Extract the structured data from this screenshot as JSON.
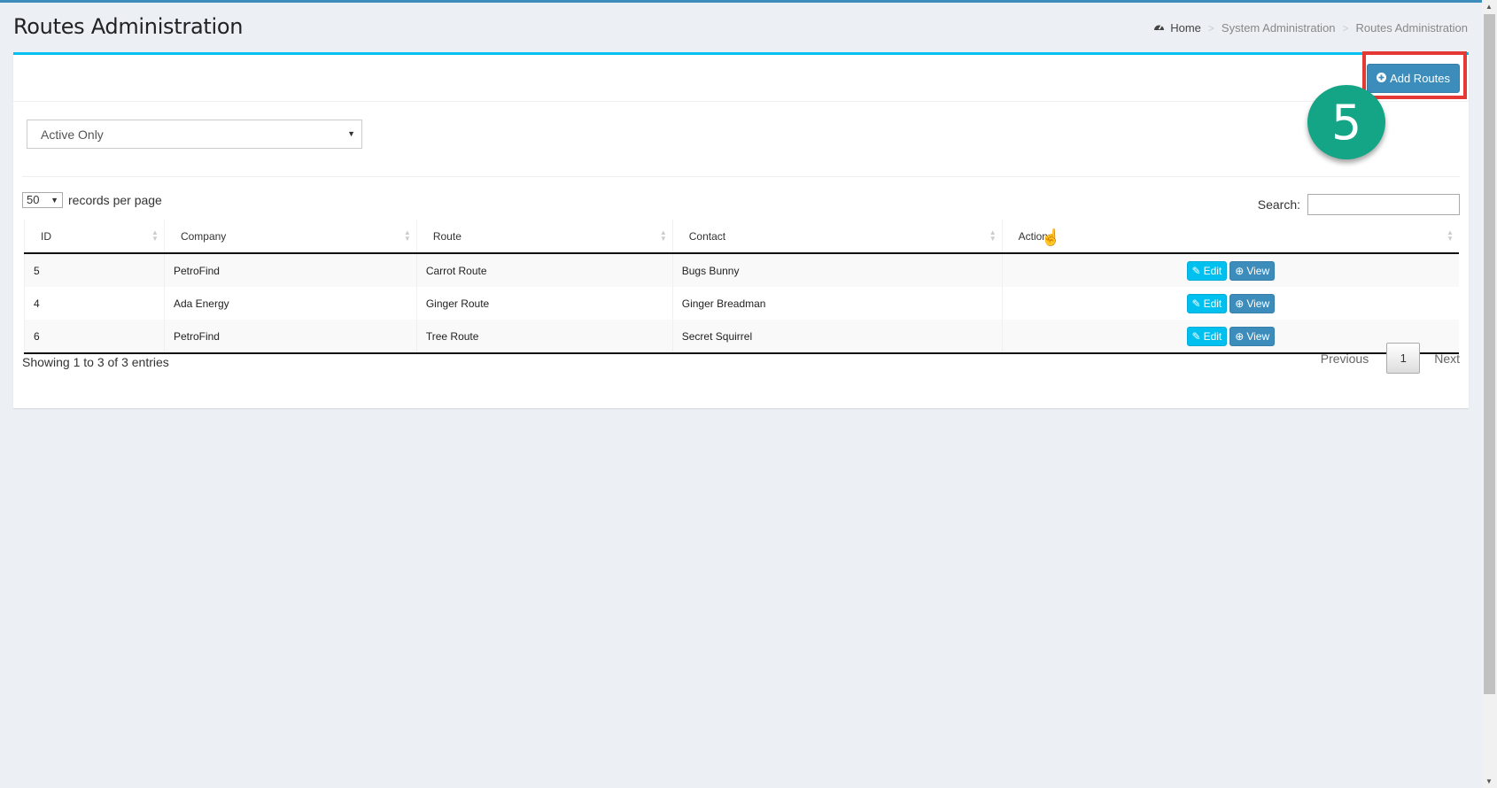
{
  "header": {
    "title": "Routes Administration",
    "breadcrumb": [
      "Home",
      "System Administration",
      "Routes Administration"
    ]
  },
  "toolbar": {
    "add_label": "Add Routes"
  },
  "annotation": {
    "step_number": "5",
    "highlight_color": "#e53935",
    "step_color": "#13a586"
  },
  "filter": {
    "selected": "Active Only"
  },
  "table_controls": {
    "length_value": "50",
    "length_suffix": "records per page",
    "search_label": "Search:"
  },
  "table": {
    "columns": [
      "ID",
      "Company",
      "Route",
      "Contact",
      "Action"
    ],
    "rows": [
      {
        "id": "5",
        "company": "PetroFind",
        "route": "Carrot Route",
        "contact": "Bugs Bunny"
      },
      {
        "id": "4",
        "company": "Ada Energy",
        "route": "Ginger Route",
        "contact": "Ginger Breadman"
      },
      {
        "id": "6",
        "company": "PetroFind",
        "route": "Tree Route",
        "contact": "Secret Squirrel"
      }
    ],
    "edit_label": "Edit",
    "view_label": "View"
  },
  "footer": {
    "info": "Showing 1 to 3 of 3 entries",
    "previous": "Previous",
    "page": "1",
    "next": "Next"
  },
  "colors": {
    "accent": "#3c8dbc",
    "info": "#00c0ef",
    "background": "#ecf0f5"
  }
}
